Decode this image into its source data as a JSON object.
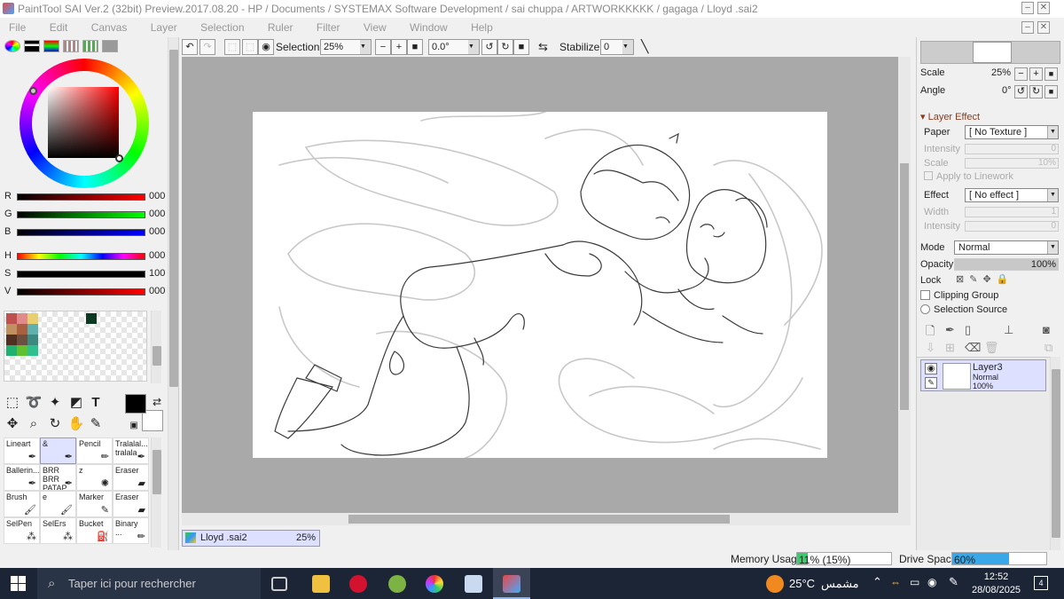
{
  "window": {
    "title": "PaintTool SAI Ver.2 (32bit) Preview.2017.08.20 - HP / Documents / SYSTEMAX Software Development / sai chuppa / ARTWORKKKKK / gagaga / Lloyd .sai2"
  },
  "menu": [
    "File",
    "Edit",
    "Canvas",
    "Layer",
    "Selection",
    "Ruler",
    "Filter",
    "View",
    "Window",
    "Help"
  ],
  "color": {
    "sliders": [
      {
        "label": "R",
        "value": "000"
      },
      {
        "label": "G",
        "value": "000"
      },
      {
        "label": "B",
        "value": "000"
      },
      {
        "label": "H",
        "value": "000"
      },
      {
        "label": "S",
        "value": "100"
      },
      {
        "label": "V",
        "value": "000"
      }
    ],
    "swatches": [
      "#c05050",
      "#e08a8a",
      "#e8d070",
      "#c09060",
      "#a86040",
      "#60b0b0",
      "#503020",
      "#6b5040",
      "#3a8a80",
      "#20b070",
      "#60c030",
      "#30c090"
    ],
    "picked": "#0b3a20"
  },
  "brushes": [
    {
      "label": "Lineart",
      "icon": "pen-icon"
    },
    {
      "label": "&",
      "icon": "pen-icon"
    },
    {
      "label": "Pencil",
      "icon": "pencil-icon"
    },
    {
      "label": "Tralalal...\ntralala",
      "icon": "pen-icon"
    },
    {
      "label": "Ballerin...",
      "icon": "pen-icon"
    },
    {
      "label": "BRR BRR\nPATAP...",
      "icon": "pen-icon"
    },
    {
      "label": "z",
      "icon": "airbrush-icon"
    },
    {
      "label": "Eraser",
      "icon": "eraser-icon"
    },
    {
      "label": "Brush",
      "icon": "brush-icon"
    },
    {
      "label": "e",
      "icon": "brush-icon"
    },
    {
      "label": "Marker",
      "icon": "marker-icon"
    },
    {
      "label": "Eraser",
      "icon": "eraser-icon"
    },
    {
      "label": "SelPen",
      "icon": "selpen-icon"
    },
    {
      "label": "SelErs",
      "icon": "selers-icon"
    },
    {
      "label": "Bucket",
      "icon": "bucket-icon"
    },
    {
      "label": "Binary ...",
      "icon": "pencil-icon"
    }
  ],
  "toolbar": {
    "selection_label": "Selection",
    "zoom": "25%",
    "rotation": "0.0°",
    "stabilizer_label": "Stabilizer",
    "stabilizer": "0"
  },
  "document": {
    "tab_name": "Lloyd .sai2",
    "tab_zoom": "25%"
  },
  "navigator": {
    "scale_label": "Scale",
    "scale": "25%",
    "angle_label": "Angle",
    "angle": "0°"
  },
  "layer_effect": {
    "header": "Layer Effect",
    "paper_label": "Paper",
    "paper": "[ No Texture ]",
    "intensity_label": "Intensity",
    "intensity": "0",
    "scale_label": "Scale",
    "scale": "10%",
    "apply_label": "Apply to Linework",
    "effect_label": "Effect",
    "effect": "[ No effect ]",
    "width_label": "Width",
    "width": "1",
    "intensity2_label": "Intensity",
    "intensity2": "0"
  },
  "layer_props": {
    "mode_label": "Mode",
    "mode": "Normal",
    "opacity_label": "Opacity",
    "opacity": "100%",
    "lock_label": "Lock",
    "clipping_label": "Clipping Group",
    "selsource_label": "Selection Source"
  },
  "layers": [
    {
      "name": "Layer3",
      "mode": "Normal",
      "opacity": "100%"
    }
  ],
  "status": {
    "memory_label": "Memory Usage",
    "memory": "11% (15%)",
    "memory_fraction": 0.11,
    "drive_label": "Drive Space",
    "drive": "60%",
    "drive_fraction": 0.6
  },
  "taskbar": {
    "search_placeholder": "Taper ici pour rechercher",
    "weather": "25°C",
    "weather_desc": "مشمس",
    "time": "12:52",
    "date": "28/08/2025",
    "notifications": "4"
  }
}
